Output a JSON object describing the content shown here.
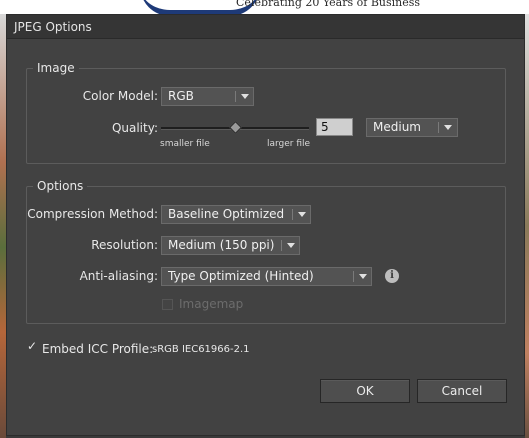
{
  "background": {
    "tagline": "Celebrating 20 Years of Business"
  },
  "dialog": {
    "title": "JPEG Options",
    "image_group": {
      "legend": "Image",
      "color_model_label": "Color Model:",
      "color_model_value": "RGB",
      "quality_label": "Quality:",
      "quality_value": "5",
      "quality_level": 0.5,
      "quality_preset": "Medium",
      "smaller_label": "smaller file",
      "larger_label": "larger file"
    },
    "options_group": {
      "legend": "Options",
      "compression_label": "Compression Method:",
      "compression_value": "Baseline Optimized",
      "resolution_label": "Resolution:",
      "resolution_value": "Medium (150 ppi)",
      "antialias_label": "Anti-aliasing:",
      "antialias_value": "Type Optimized (Hinted)",
      "imagemap_label": "Imagemap",
      "imagemap_checked": false,
      "imagemap_enabled": false
    },
    "embed_icc": {
      "label": "Embed ICC Profile:",
      "profile": "sRGB IEC61966-2.1",
      "checked": true
    },
    "buttons": {
      "ok": "OK",
      "cancel": "Cancel"
    }
  },
  "icons": {
    "info": "info-icon",
    "dropdown": "chevron-down-icon",
    "check": "checkmark-icon"
  }
}
